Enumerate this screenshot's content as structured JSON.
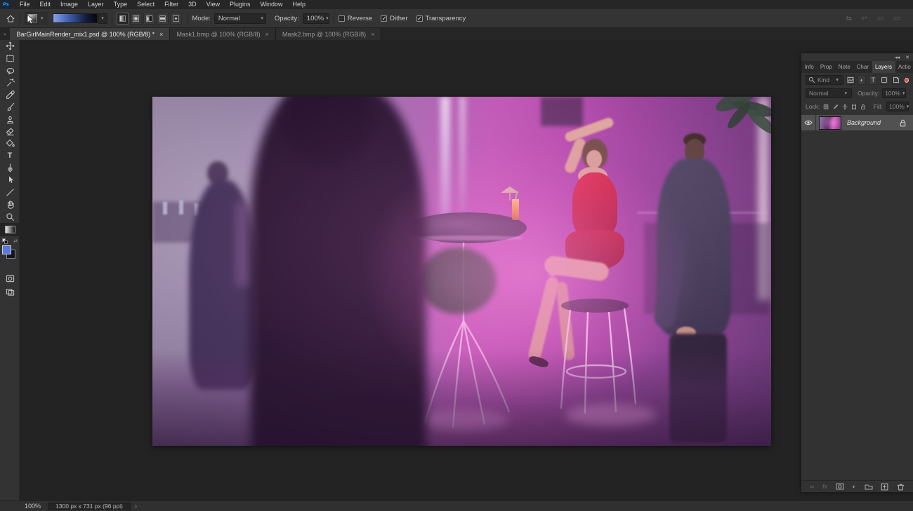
{
  "app": {
    "logo_text": "Ps"
  },
  "menu": {
    "items": [
      "File",
      "Edit",
      "Image",
      "Layer",
      "Type",
      "Select",
      "Filter",
      "3D",
      "View",
      "Plugins",
      "Window",
      "Help"
    ]
  },
  "options": {
    "mode_label": "Mode:",
    "mode_value": "Normal",
    "opacity_label": "Opacity:",
    "opacity_value": "100%",
    "checkboxes": [
      {
        "label": "Reverse",
        "checked": false
      },
      {
        "label": "Dither",
        "checked": true
      },
      {
        "label": "Transparency",
        "checked": true
      }
    ],
    "gradient_types": [
      "linear",
      "radial",
      "angle",
      "reflected",
      "diamond"
    ],
    "selected_gradient_type": "linear"
  },
  "document_tabs": [
    {
      "label": "BarGirlMainRender_mix1.psd @ 100% (RGB/8) *",
      "close": "×",
      "active": true
    },
    {
      "label": "Mask1.bmp @ 100% (RGB/8)",
      "close": "×",
      "active": false
    },
    {
      "label": "Mask2.bmp @ 100% (RGB/8)",
      "close": "×",
      "active": false
    }
  ],
  "toolbar": {
    "tools": [
      "move",
      "rectangular-marquee",
      "lasso",
      "magic-wand",
      "eyedropper",
      "brush",
      "clone-stamp",
      "eraser",
      "paint-bucket",
      "type",
      "pen",
      "path-select",
      "line",
      "hand",
      "zoom",
      "gradient"
    ],
    "selected_tool": "gradient",
    "type_tool_glyph": "T",
    "foreground_color": "#5a78dd",
    "background_color": "#15161d"
  },
  "layers_panel": {
    "collapse_glyph": "◂◂",
    "close_glyph": "✕",
    "menu_glyph": "≡",
    "tabs": [
      {
        "label": "Info"
      },
      {
        "label": "Prop"
      },
      {
        "label": "Note"
      },
      {
        "label": "Char"
      },
      {
        "label": "Layers",
        "active": true
      },
      {
        "label": "Actio"
      }
    ],
    "search_value": "Kind",
    "blend_mode": "Normal",
    "opacity_label": "Opacity:",
    "opacity_value": "100%",
    "lock_label": "Lock:",
    "fill_label": "Fill:",
    "fill_value": "100%",
    "layers": [
      {
        "name": "Background",
        "visible": true,
        "locked": true
      }
    ],
    "footer_fx_label": "fx",
    "footer_link_glyph": "∞",
    "footer_adjust_glyph": "◐",
    "adjust_glyph": "◐"
  },
  "status_bar": {
    "zoom_level": "100%",
    "doc_info": "1300 px x 731 px (96 ppi)",
    "expander": "›"
  },
  "tab_overflow_glyph": "»",
  "colors": {
    "accent_blue": "#57b2ff",
    "foreground_swatch": "#5a78dd",
    "filter_dot_red": "#e04848",
    "canvas_magenta": "#c05ab6"
  }
}
